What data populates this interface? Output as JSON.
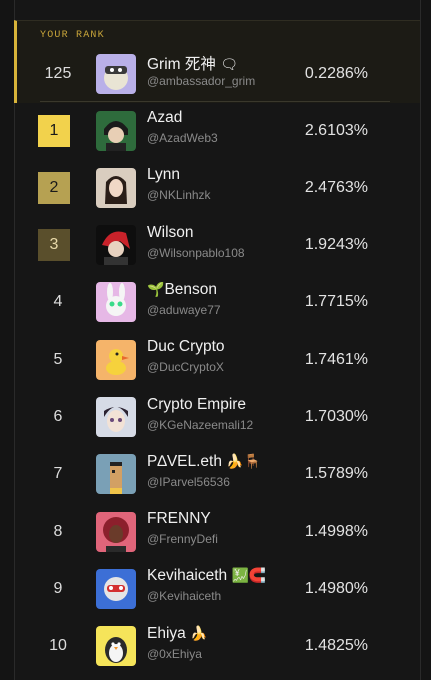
{
  "header": {
    "label": "YOUR RANK"
  },
  "colors": {
    "accent": "#d8b43a",
    "rank1": "#f2d24c",
    "rank2": "#b6a152",
    "rank3": "#5a4f2c"
  },
  "me": {
    "rank": "125",
    "name": "Grim 死神",
    "name_emoji": "🗨",
    "handle": "@ambassador_grim",
    "share": "0.2286%",
    "avatar": "moon-cat-avatar"
  },
  "rows": [
    {
      "rank": "1",
      "name": "Azad",
      "name_emoji": "",
      "handle": "@AzadWeb3",
      "share": "2.6103%",
      "avatar": "anime-boy-avatar"
    },
    {
      "rank": "2",
      "name": "Lynn",
      "name_emoji": "",
      "handle": "@NKLinhzk",
      "share": "2.4763%",
      "avatar": "woman-photo-avatar"
    },
    {
      "rank": "3",
      "name": "Wilson",
      "name_emoji": "",
      "handle": "@Wilsonpablo108",
      "share": "1.9243%",
      "avatar": "red-hair-avatar"
    },
    {
      "rank": "4",
      "name": "Benson",
      "name_emoji_pre": "🌱",
      "name_emoji": "",
      "handle": "@aduwaye77",
      "share": "1.7715%",
      "avatar": "bunny-avatar"
    },
    {
      "rank": "5",
      "name": "Duc Crypto",
      "name_emoji": "",
      "handle": "@DucCryptoX",
      "share": "1.7461%",
      "avatar": "duck-avatar"
    },
    {
      "rank": "6",
      "name": "Crypto Empire",
      "name_emoji": "",
      "handle": "@KGeNazeemali12",
      "share": "1.7030%",
      "avatar": "anime-face-avatar"
    },
    {
      "rank": "7",
      "name": "P∆VEL.eth",
      "name_emoji": "🍌🪑",
      "handle": "@IParvel56536",
      "share": "1.5789%",
      "avatar": "pixel-punk-avatar"
    },
    {
      "rank": "8",
      "name": "FRENNY",
      "name_emoji": "",
      "handle": "@FrennyDefi",
      "share": "1.4998%",
      "avatar": "curly-hair-avatar"
    },
    {
      "rank": "9",
      "name": "Kevihaiceth",
      "name_emoji": "💹🧲",
      "handle": "@Kevihaiceth",
      "share": "1.4980%",
      "avatar": "robot-avatar"
    },
    {
      "rank": "10",
      "name": "Ehiya",
      "name_emoji": "🍌",
      "handle": "@0xEhiya",
      "share": "1.4825%",
      "avatar": "penguin-avatar"
    }
  ]
}
